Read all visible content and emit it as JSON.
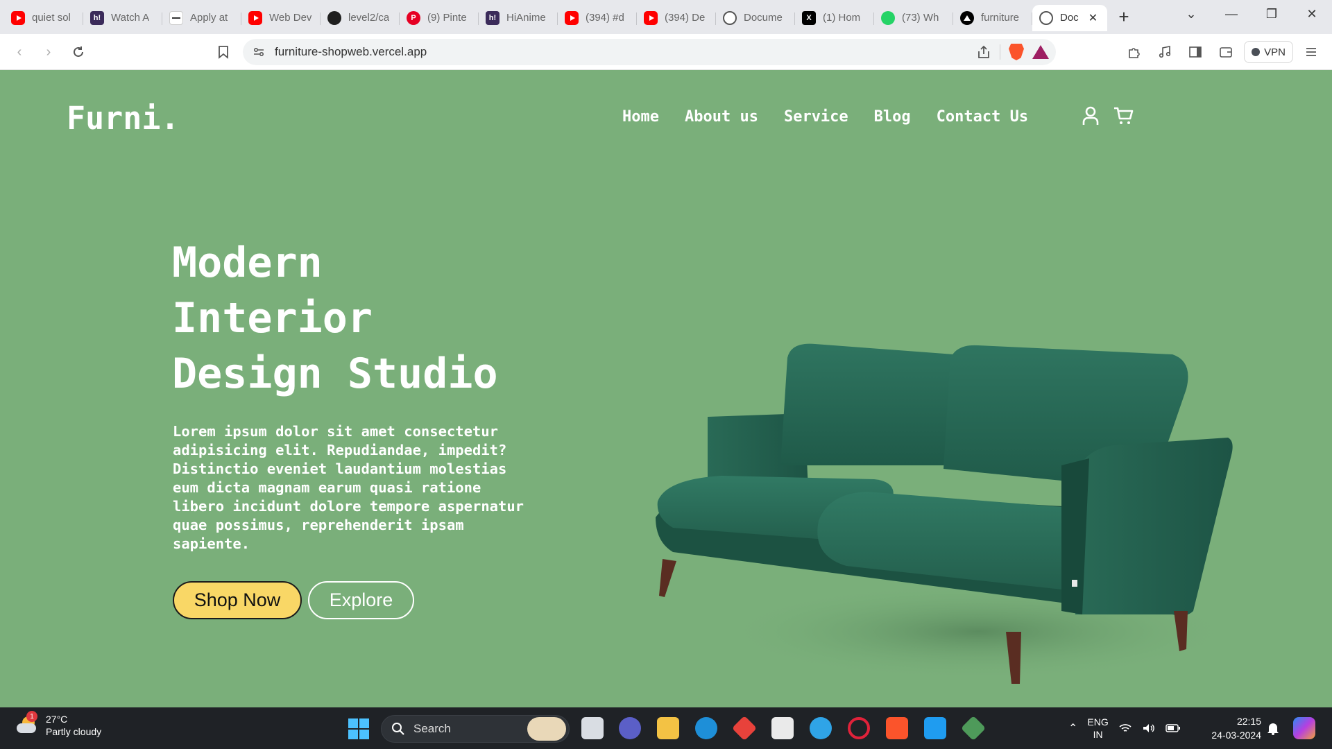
{
  "browser": {
    "tabs": [
      {
        "title": "quiet sol",
        "favicon": "youtube-icon"
      },
      {
        "title": "Watch A",
        "favicon": "hianime-icon"
      },
      {
        "title": "Apply at",
        "favicon": "generic-site-icon"
      },
      {
        "title": "Web Dev",
        "favicon": "youtube-icon"
      },
      {
        "title": "level2/ca",
        "favicon": "github-icon"
      },
      {
        "title": "(9) Pinte",
        "favicon": "pinterest-icon"
      },
      {
        "title": "HiAnime",
        "favicon": "hianime-icon"
      },
      {
        "title": "(394) #d",
        "favicon": "youtube-icon"
      },
      {
        "title": "(394) De",
        "favicon": "youtube-icon"
      },
      {
        "title": "Docume",
        "favicon": "globe-icon"
      },
      {
        "title": "(1) Hom",
        "favicon": "x-icon"
      },
      {
        "title": "(73) Wh",
        "favicon": "whatsapp-icon"
      },
      {
        "title": "furniture",
        "favicon": "vercel-icon"
      },
      {
        "title": "Doc",
        "favicon": "globe-icon",
        "active": true
      }
    ],
    "address": "furniture-shopweb.vercel.app",
    "vpn_label": "VPN"
  },
  "site": {
    "logo": "Furni.",
    "nav": [
      "Home",
      "About us",
      "Service",
      "Blog",
      "Contact Us"
    ],
    "hero": {
      "title_lines": [
        "Modern",
        "Interior",
        "Design Studio"
      ],
      "text_lines": [
        "Lorem ipsum dolor sit amet consectetur",
        "adipisicing elit. Repudiandae, impedit?",
        "Distinctio eveniet laudantium molestias",
        "eum dicta magnam earum quasi ratione",
        "libero incidunt dolore tempore aspernatur",
        "quae possimus, reprehenderit ipsam",
        "sapiente."
      ],
      "primary_button": "Shop Now",
      "secondary_button": "Explore"
    },
    "colors": {
      "background": "#7aaf7a",
      "primary_button": "#f9d766",
      "sofa": "#2c6b57"
    }
  },
  "taskbar": {
    "weather_temp": "27°C",
    "weather_desc": "Partly cloudy",
    "weather_badge": "1",
    "search_placeholder": "Search",
    "lang_top": "ENG",
    "lang_bottom": "IN",
    "time": "22:15",
    "date": "24-03-2024"
  }
}
